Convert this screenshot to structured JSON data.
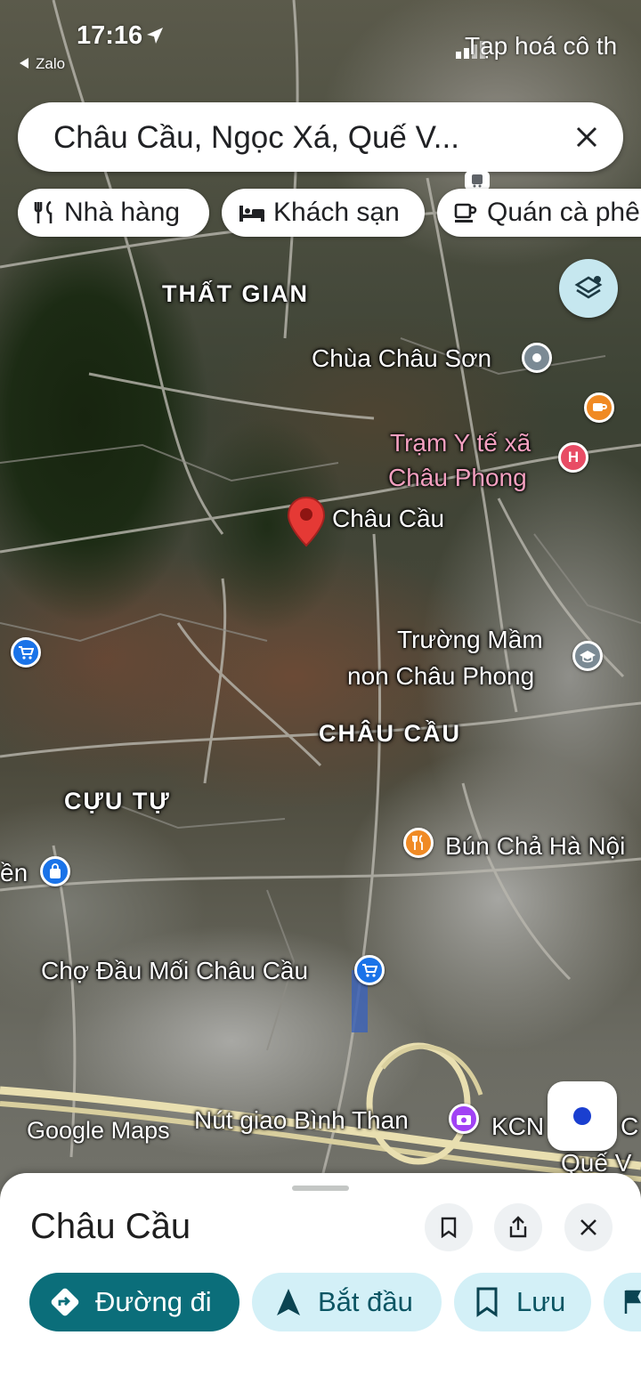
{
  "status_bar": {
    "time": "17:16",
    "back_app": "Zalo",
    "right_overlay_text": "Tạp hoá cô th"
  },
  "search": {
    "value": "Châu Cầu, Ngọc Xá, Quế V..."
  },
  "chips": [
    {
      "label": "Nhà hàng",
      "icon": "restaurant-icon"
    },
    {
      "label": "Khách sạn",
      "icon": "hotel-icon"
    },
    {
      "label": "Quán cà phê",
      "icon": "coffee-icon"
    }
  ],
  "map": {
    "areas": [
      "THẤT GIAN",
      "CHÂU CẦU",
      "CỰU TỰ"
    ],
    "places": {
      "chua_chau_son": "Chùa Châu Sơn",
      "tram_y_te_line1": "Trạm Y tế xã",
      "tram_y_te_line2": "Châu Phong",
      "selected": "Châu Cầu",
      "truong_line1": "Trường Mầm",
      "truong_line2": "non Châu Phong",
      "bun_cha": "Bún Chả Hà Nội",
      "en_partial": "ền",
      "cho_dau_moi": "Chợ Đầu Mối Châu Cầu",
      "nut_giao": "Nút giao Bình Than",
      "kcn": "KCN",
      "que_v_partial": "Quế V",
      "c_partial": "C"
    },
    "attribution": "Google Maps",
    "colors": {
      "pin_red": "#e53935",
      "poi_gray": "#7b8a94",
      "poi_orange": "#f08a24",
      "poi_blue": "#1a73e8",
      "poi_purple": "#a142f4",
      "hospital_red": "#e84c65"
    }
  },
  "sheet": {
    "title": "Châu Cầu",
    "actions": [
      {
        "label": "Đường đi",
        "icon": "directions-icon"
      },
      {
        "label": "Bắt đầu",
        "icon": "navigation-arrow-icon"
      },
      {
        "label": "Lưu",
        "icon": "bookmark-icon"
      }
    ]
  }
}
